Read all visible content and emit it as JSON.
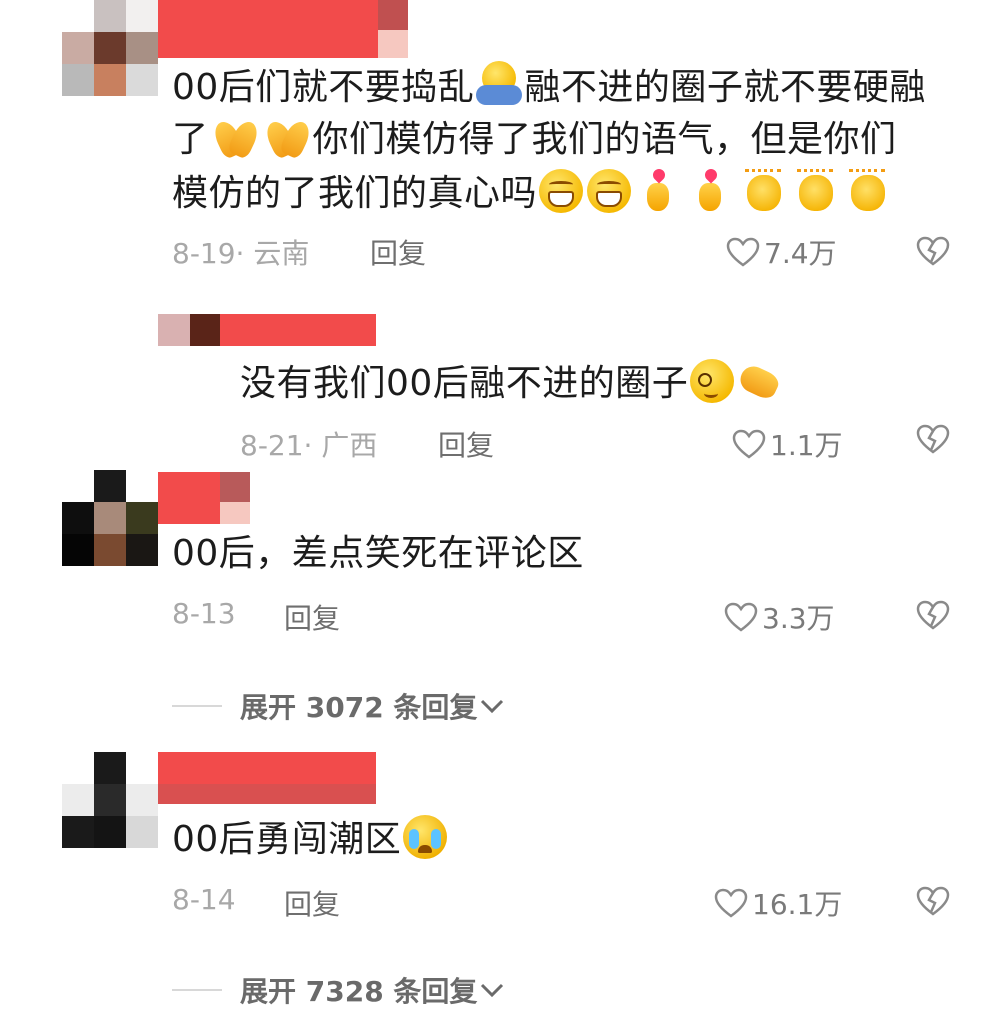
{
  "comments": [
    {
      "text_lines": [
        "00后们就不要捣乱",
        "融不进的圈子就不要硬融",
        "了",
        "你们模仿得了我们的语气，但是你们",
        "模仿的了我们的真心吗"
      ],
      "date": "8-19",
      "location": "云南",
      "reply_label": "回复",
      "likes": "7.4万"
    },
    {
      "text": "没有我们00后融不进的圈子",
      "date": "8-21",
      "location": "广西",
      "reply_label": "回复",
      "likes": "1.1万"
    },
    {
      "text": "00后，差点笑死在评论区",
      "date": "8-13",
      "reply_label": "回复",
      "likes": "3.3万",
      "expand_label": "展开 3072 条回复"
    },
    {
      "text": "00后勇闯潮区",
      "date": "8-14",
      "reply_label": "回复",
      "likes": "16.1万",
      "expand_label": "展开 7328 条回复"
    }
  ],
  "colors": {
    "redacted_name": "#f24b4b",
    "meta_gray": "#a8a8a8",
    "text": "#1c1c1c"
  },
  "icons": [
    "heart-outline-icon",
    "broken-heart-icon",
    "chevron-down-icon"
  ]
}
